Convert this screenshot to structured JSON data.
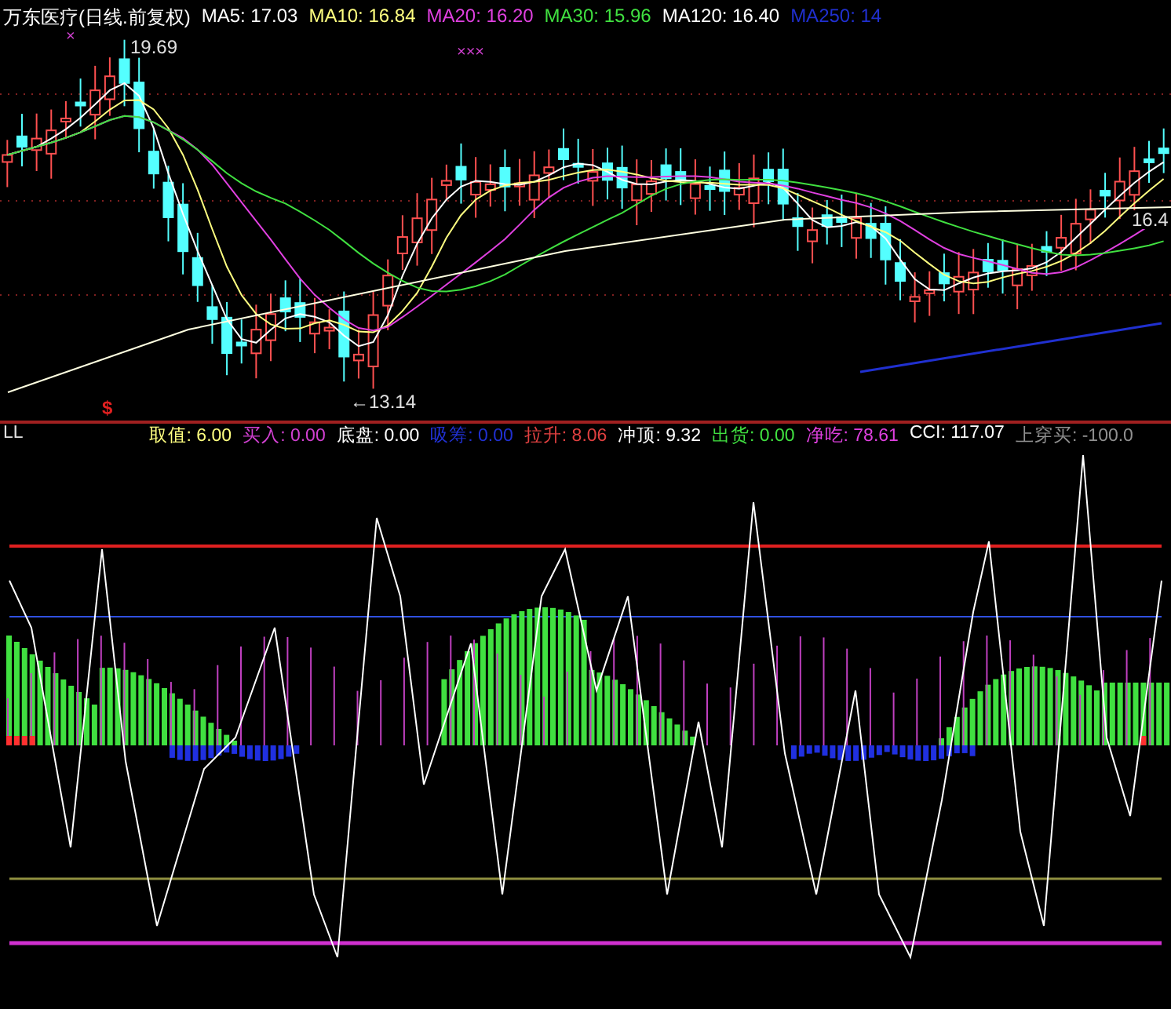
{
  "price_panel": {
    "title": "万东医疗(日线.前复权)",
    "ma_lines": [
      {
        "text": "MA5: 17.03",
        "color": "#ffffff"
      },
      {
        "text": "MA10: 16.84",
        "color": "#ffff80"
      },
      {
        "text": "MA20: 16.20",
        "color": "#e040e0"
      },
      {
        "text": "MA30: 15.96",
        "color": "#40e040"
      },
      {
        "text": "MA120: 16.40",
        "color": "#ffffff"
      },
      {
        "text": "MA250: 14",
        "color": "#2030d0"
      }
    ],
    "marks": [
      {
        "kind": "cross",
        "text": "×"
      },
      {
        "kind": "cross",
        "text": "×××"
      },
      {
        "kind": "high",
        "text": "19.69"
      },
      {
        "kind": "low",
        "text": "←13.14"
      },
      {
        "kind": "dollar",
        "text": "$"
      },
      {
        "kind": "last",
        "text": "16.4"
      }
    ]
  },
  "indicator_panel": {
    "name": "LL",
    "values": [
      {
        "text": "取值: 6.00",
        "color": "#ffff80"
      },
      {
        "text": "买入: 0.00",
        "color": "#d040d0"
      },
      {
        "text": "底盘: 0.00",
        "color": "#ffffff"
      },
      {
        "text": "吸筹: 0.00",
        "color": "#2030d0"
      },
      {
        "text": "拉升: 8.06",
        "color": "#e04040"
      },
      {
        "text": "冲顶: 9.32",
        "color": "#ffffff"
      },
      {
        "text": "出货: 0.00",
        "color": "#40e040"
      },
      {
        "text": "净吃: 78.61",
        "color": "#e040e0"
      },
      {
        "text": "CCI: 117.07",
        "color": "#ffffff"
      },
      {
        "text": "上穿买: -100.0",
        "color": "#909090"
      }
    ]
  }
}
